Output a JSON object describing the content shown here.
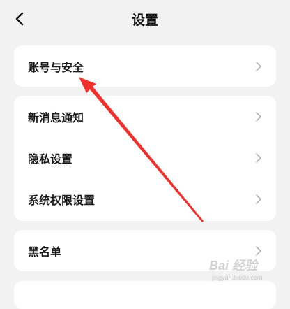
{
  "header": {
    "title": "设置"
  },
  "groups": [
    {
      "items": [
        {
          "label": "账号与安全"
        }
      ]
    },
    {
      "items": [
        {
          "label": "新消息通知"
        },
        {
          "label": "隐私设置"
        },
        {
          "label": "系统权限设置"
        }
      ]
    },
    {
      "items": [
        {
          "label": "黑名单"
        }
      ]
    }
  ],
  "watermark": {
    "main": "Bai 经验",
    "sub": "jingyan.baidu.com"
  },
  "colors": {
    "background": "#f2f2f2",
    "card": "#ffffff",
    "arrow": "#f0302a"
  }
}
